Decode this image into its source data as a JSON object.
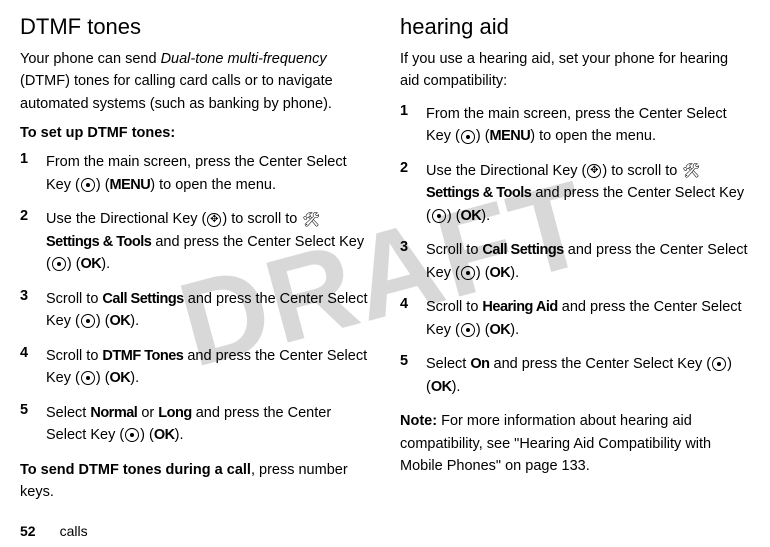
{
  "watermark": "DRAFT",
  "left": {
    "heading": "DTMF tones",
    "intro_pre": "Your phone can send ",
    "intro_italic": "Dual-tone multi-frequency",
    "intro_post": " (DTMF) tones for calling card calls or to navigate automated systems (such as banking by phone).",
    "subhead": "To set up DTMF tones:",
    "steps": [
      {
        "num": "1",
        "pre": "From the main screen, press the Center Select Key (",
        "mid1": ") (",
        "bold1": "MENU",
        "post1": ") to open the menu."
      },
      {
        "num": "2",
        "pre": "Use the Directional Key (",
        "mid1": ") to scroll to ",
        "bold1": "Settings & Tools",
        "mid2": " and press the Center Select Key (",
        "mid3": ") (",
        "bold2": "OK",
        "post": ")."
      },
      {
        "num": "3",
        "pre": "Scroll to ",
        "bold1": "Call Settings",
        "mid1": " and press the Center Select Key (",
        "mid2": ") (",
        "bold2": "OK",
        "post": ")."
      },
      {
        "num": "4",
        "pre": "Scroll to ",
        "bold1": "DTMF Tones",
        "mid1": " and press the Center Select Key (",
        "mid2": ") (",
        "bold2": "OK",
        "post": ")."
      },
      {
        "num": "5",
        "pre": "Select ",
        "bold1": "Normal",
        "mid1": " or ",
        "bold2": "Long",
        "mid2": " and press the Center Select Key (",
        "mid3": ") (",
        "bold3": "OK",
        "post": ")."
      }
    ],
    "closing_bold": "To send DTMF tones during a call",
    "closing_post": ", press number keys."
  },
  "right": {
    "heading": "hearing aid",
    "intro": "If you use a hearing aid, set your phone for hearing aid compatibility:",
    "steps": [
      {
        "num": "1",
        "pre": "From the main screen, press the Center Select Key (",
        "mid1": ") (",
        "bold1": "MENU",
        "post1": ") to open the menu."
      },
      {
        "num": "2",
        "pre": "Use the Directional Key (",
        "mid1": ") to scroll to ",
        "bold1": "Settings & Tools",
        "mid2": " and press the Center Select Key (",
        "mid3": ") (",
        "bold2": "OK",
        "post": ")."
      },
      {
        "num": "3",
        "pre": "Scroll to ",
        "bold1": "Call Settings",
        "mid1": " and press the Center Select Key (",
        "mid2": ") (",
        "bold2": "OK",
        "post": ")."
      },
      {
        "num": "4",
        "pre": "Scroll to ",
        "bold1": "Hearing Aid",
        "mid1": " and press the Center Select Key (",
        "mid2": ") (",
        "bold2": "OK",
        "post": ")."
      },
      {
        "num": "5",
        "pre": "Select ",
        "bold1": "On",
        "mid1": " and press the Center Select Key (",
        "mid2": ") (",
        "bold2": "OK",
        "post": ")."
      }
    ],
    "note_bold": "Note:",
    "note_text": " For more information about hearing aid compatibility, see \"Hearing Aid Compatibility with Mobile Phones\" on page 133."
  },
  "footer": {
    "page": "52",
    "section": "calls"
  }
}
